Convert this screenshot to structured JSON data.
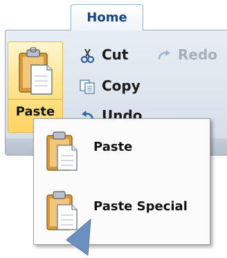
{
  "ribbon": {
    "active_tab": "Home",
    "paste_button_label": "Paste",
    "commands": {
      "cut_label": "Cut",
      "copy_label": "Copy",
      "undo_label": "Undo",
      "redo_label": "Redo",
      "redo_enabled": false
    },
    "icons": {
      "paste": "clipboard-icon",
      "cut": "scissors-icon",
      "copy": "copy-icon",
      "undo": "undo-icon",
      "redo": "redo-icon"
    }
  },
  "paste_menu": {
    "items": [
      {
        "label": "Paste",
        "icon": "clipboard-icon"
      },
      {
        "label": "Paste Special",
        "icon": "clipboard-icon"
      }
    ]
  },
  "colors": {
    "highlight_top": "#fff6cf",
    "highlight_bottom": "#ffd460",
    "tab_text": "#15428b",
    "disabled_text": "#a7aeb8"
  }
}
